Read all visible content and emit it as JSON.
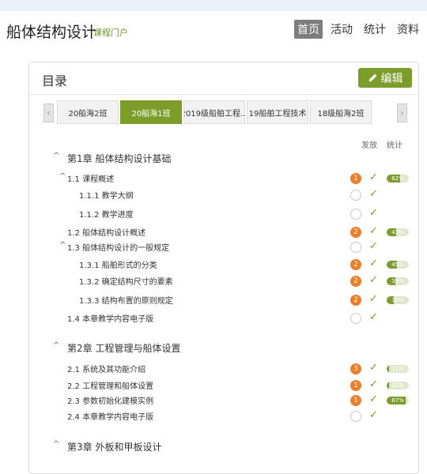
{
  "header": {
    "title": "船体结构设计",
    "subtitle": "课程门户",
    "nav": [
      "首页",
      "活动",
      "统计",
      "资料"
    ]
  },
  "panel": {
    "title": "目录",
    "edit_label": "编辑",
    "tabs": [
      "20船海2班",
      "20船海1班",
      "2019级船舶工程...",
      "19船舶工程技术",
      "18级船海2班"
    ],
    "active_tab": 1,
    "col_heads": {
      "publish": "发放",
      "stats": "统计"
    }
  },
  "toc": [
    {
      "level": "chapter",
      "caret": "^",
      "text": "第1章 船体结构设计基础"
    },
    {
      "level": "section",
      "caret": "^",
      "text": "1.1  课程概述",
      "badge": "1",
      "pct": "62%",
      "pct_value": 62
    },
    {
      "level": "sub",
      "text": "1.1.1 教学大纲"
    },
    {
      "level": "sub",
      "text": "1.1.2 教学进度"
    },
    {
      "level": "section",
      "text": "1.2  船体结构设计概述",
      "badge": "2",
      "pct": "43%",
      "pct_value": 43
    },
    {
      "level": "section",
      "caret": "^",
      "text": "1.3  船体结构设计的一般规定"
    },
    {
      "level": "sub",
      "text": "1.3.1 船舶形式的分类",
      "badge": "2",
      "pct": "45%",
      "pct_value": 45
    },
    {
      "level": "sub",
      "text": "1.3.2 确定结构尺寸的要素",
      "badge": "2",
      "pct": "39%",
      "pct_value": 39
    },
    {
      "level": "sub",
      "text": "1.3.3 结构布置的原则规定",
      "badge": "2",
      "pct": "33%",
      "pct_value": 33
    },
    {
      "level": "section",
      "text": "1.4  本章教学内容电子版"
    },
    {
      "level": "chapter",
      "caret": "^",
      "text": "第2章 工程管理与船体设置"
    },
    {
      "level": "section",
      "text": "2.1  系统及其功能介绍",
      "badge": "3",
      "pct": "11%",
      "pct_value": 11
    },
    {
      "level": "section",
      "text": "2.2  工程管理和船体设置",
      "badge": "1",
      "pct": "12%",
      "pct_value": 12
    },
    {
      "level": "section",
      "text": "2.3  参数初始化建模实例",
      "badge": "1",
      "pct": "87%",
      "pct_value": 87
    },
    {
      "level": "section",
      "text": "2.4  本章教学内容电子版"
    },
    {
      "level": "chapter",
      "caret": "^",
      "text": "第3章 外板和甲板设计"
    }
  ],
  "colors": {
    "accent": "#7d9d2a",
    "badge": "#ef7d26",
    "nav_active": "#7d7d7d"
  },
  "icons": {
    "edit": "pencil-icon",
    "check": "check-icon",
    "caret": "caret-up-icon"
  }
}
